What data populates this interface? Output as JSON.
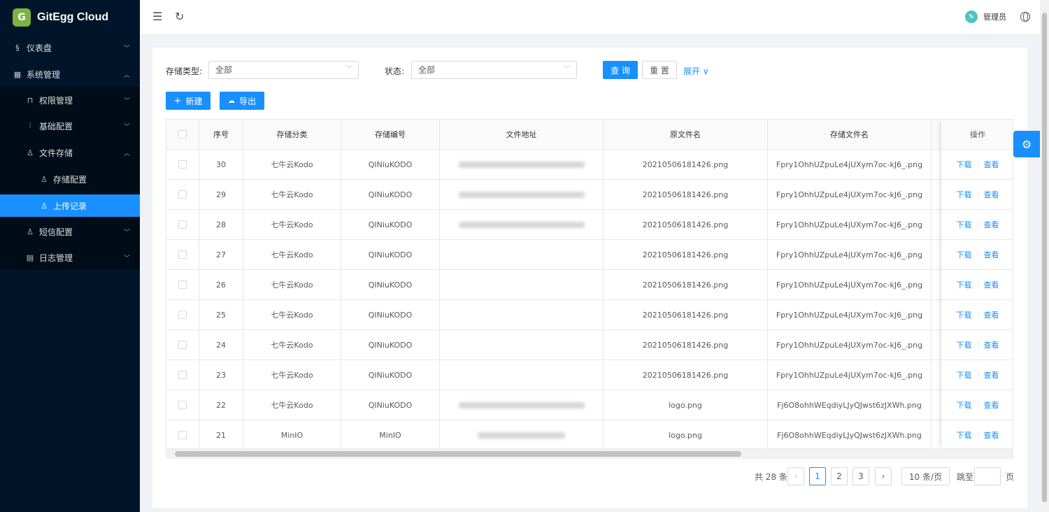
{
  "app": {
    "logo_text": "GitEgg Cloud",
    "logo_glyph": "G"
  },
  "sidebar": {
    "items": [
      {
        "label": "仪表盘",
        "icon": "dashboard-icon"
      },
      {
        "label": "系统管理",
        "icon": "system-icon"
      },
      {
        "label": "权限管理",
        "icon": "lock-icon"
      },
      {
        "label": "基础配置",
        "icon": "settings-sliders-icon"
      },
      {
        "label": "文件存储",
        "icon": "user-icon"
      },
      {
        "label": "存储配置",
        "icon": "user-icon"
      },
      {
        "label": "上传记录",
        "icon": "user-icon"
      },
      {
        "label": "短信配置",
        "icon": "user-icon"
      },
      {
        "label": "日志管理",
        "icon": "log-icon"
      }
    ]
  },
  "header": {
    "user_name": "管理员"
  },
  "filters": {
    "storage_type_label": "存储类型:",
    "storage_type_value": "全部",
    "status_label": "状态:",
    "status_value": "全部",
    "query_button": "查 询",
    "reset_button": "重 置",
    "expand_link": "展开"
  },
  "toolbar": {
    "new_button": "新建",
    "export_button": "导出"
  },
  "table": {
    "columns": [
      "序号",
      "存储分类",
      "存储编号",
      "文件地址",
      "原文件名",
      "存储文件名",
      "操作"
    ],
    "rows": [
      {
        "no": "30",
        "category": "七牛云Kodo",
        "code": "QINiuKODO",
        "original": "20210506181426.png",
        "stored": "Fpry1OhhUZpuLe4jUXym7oc-kJ6_.png"
      },
      {
        "no": "29",
        "category": "七牛云Kodo",
        "code": "QINiuKODO",
        "original": "20210506181426.png",
        "stored": "Fpry1OhhUZpuLe4jUXym7oc-kJ6_.png"
      },
      {
        "no": "28",
        "category": "七牛云Kodo",
        "code": "QINiuKODO",
        "original": "20210506181426.png",
        "stored": "Fpry1OhhUZpuLe4jUXym7oc-kJ6_.png"
      },
      {
        "no": "27",
        "category": "七牛云Kodo",
        "code": "QINiuKODO",
        "original": "20210506181426.png",
        "stored": "Fpry1OhhUZpuLe4jUXym7oc-kJ6_.png"
      },
      {
        "no": "26",
        "category": "七牛云Kodo",
        "code": "QINiuKODO",
        "original": "20210506181426.png",
        "stored": "Fpry1OhhUZpuLe4jUXym7oc-kJ6_.png"
      },
      {
        "no": "25",
        "category": "七牛云Kodo",
        "code": "QINiuKODO",
        "original": "20210506181426.png",
        "stored": "Fpry1OhhUZpuLe4jUXym7oc-kJ6_.png"
      },
      {
        "no": "24",
        "category": "七牛云Kodo",
        "code": "QINiuKODO",
        "original": "20210506181426.png",
        "stored": "Fpry1OhhUZpuLe4jUXym7oc-kJ6_.png"
      },
      {
        "no": "23",
        "category": "七牛云Kodo",
        "code": "QINiuKODO",
        "original": "20210506181426.png",
        "stored": "Fpry1OhhUZpuLe4jUXym7oc-kJ6_.png"
      },
      {
        "no": "22",
        "category": "七牛云Kodo",
        "code": "QINiuKODO",
        "original": "logo.png",
        "stored": "Fj6O8ohhWEqdiyLJyQJwst6zJXWh.png"
      },
      {
        "no": "21",
        "category": "MinIO",
        "code": "MinIO",
        "original": "logo.png",
        "stored": "Fj6O8ohhWEqdiyLJyQJwst6zJXWh.png"
      }
    ],
    "download_label": "下载",
    "view_label": "查看"
  },
  "pagination": {
    "total_text": "共 28 条",
    "pages": [
      "1",
      "2",
      "3"
    ],
    "current": "1",
    "page_size": "10 条/页",
    "jump_label": "跳至",
    "page_suffix": "页"
  },
  "colors": {
    "primary": "#1890ff",
    "sidebar_bg": "#001529",
    "sidebar_sub_bg": "#000c17"
  }
}
